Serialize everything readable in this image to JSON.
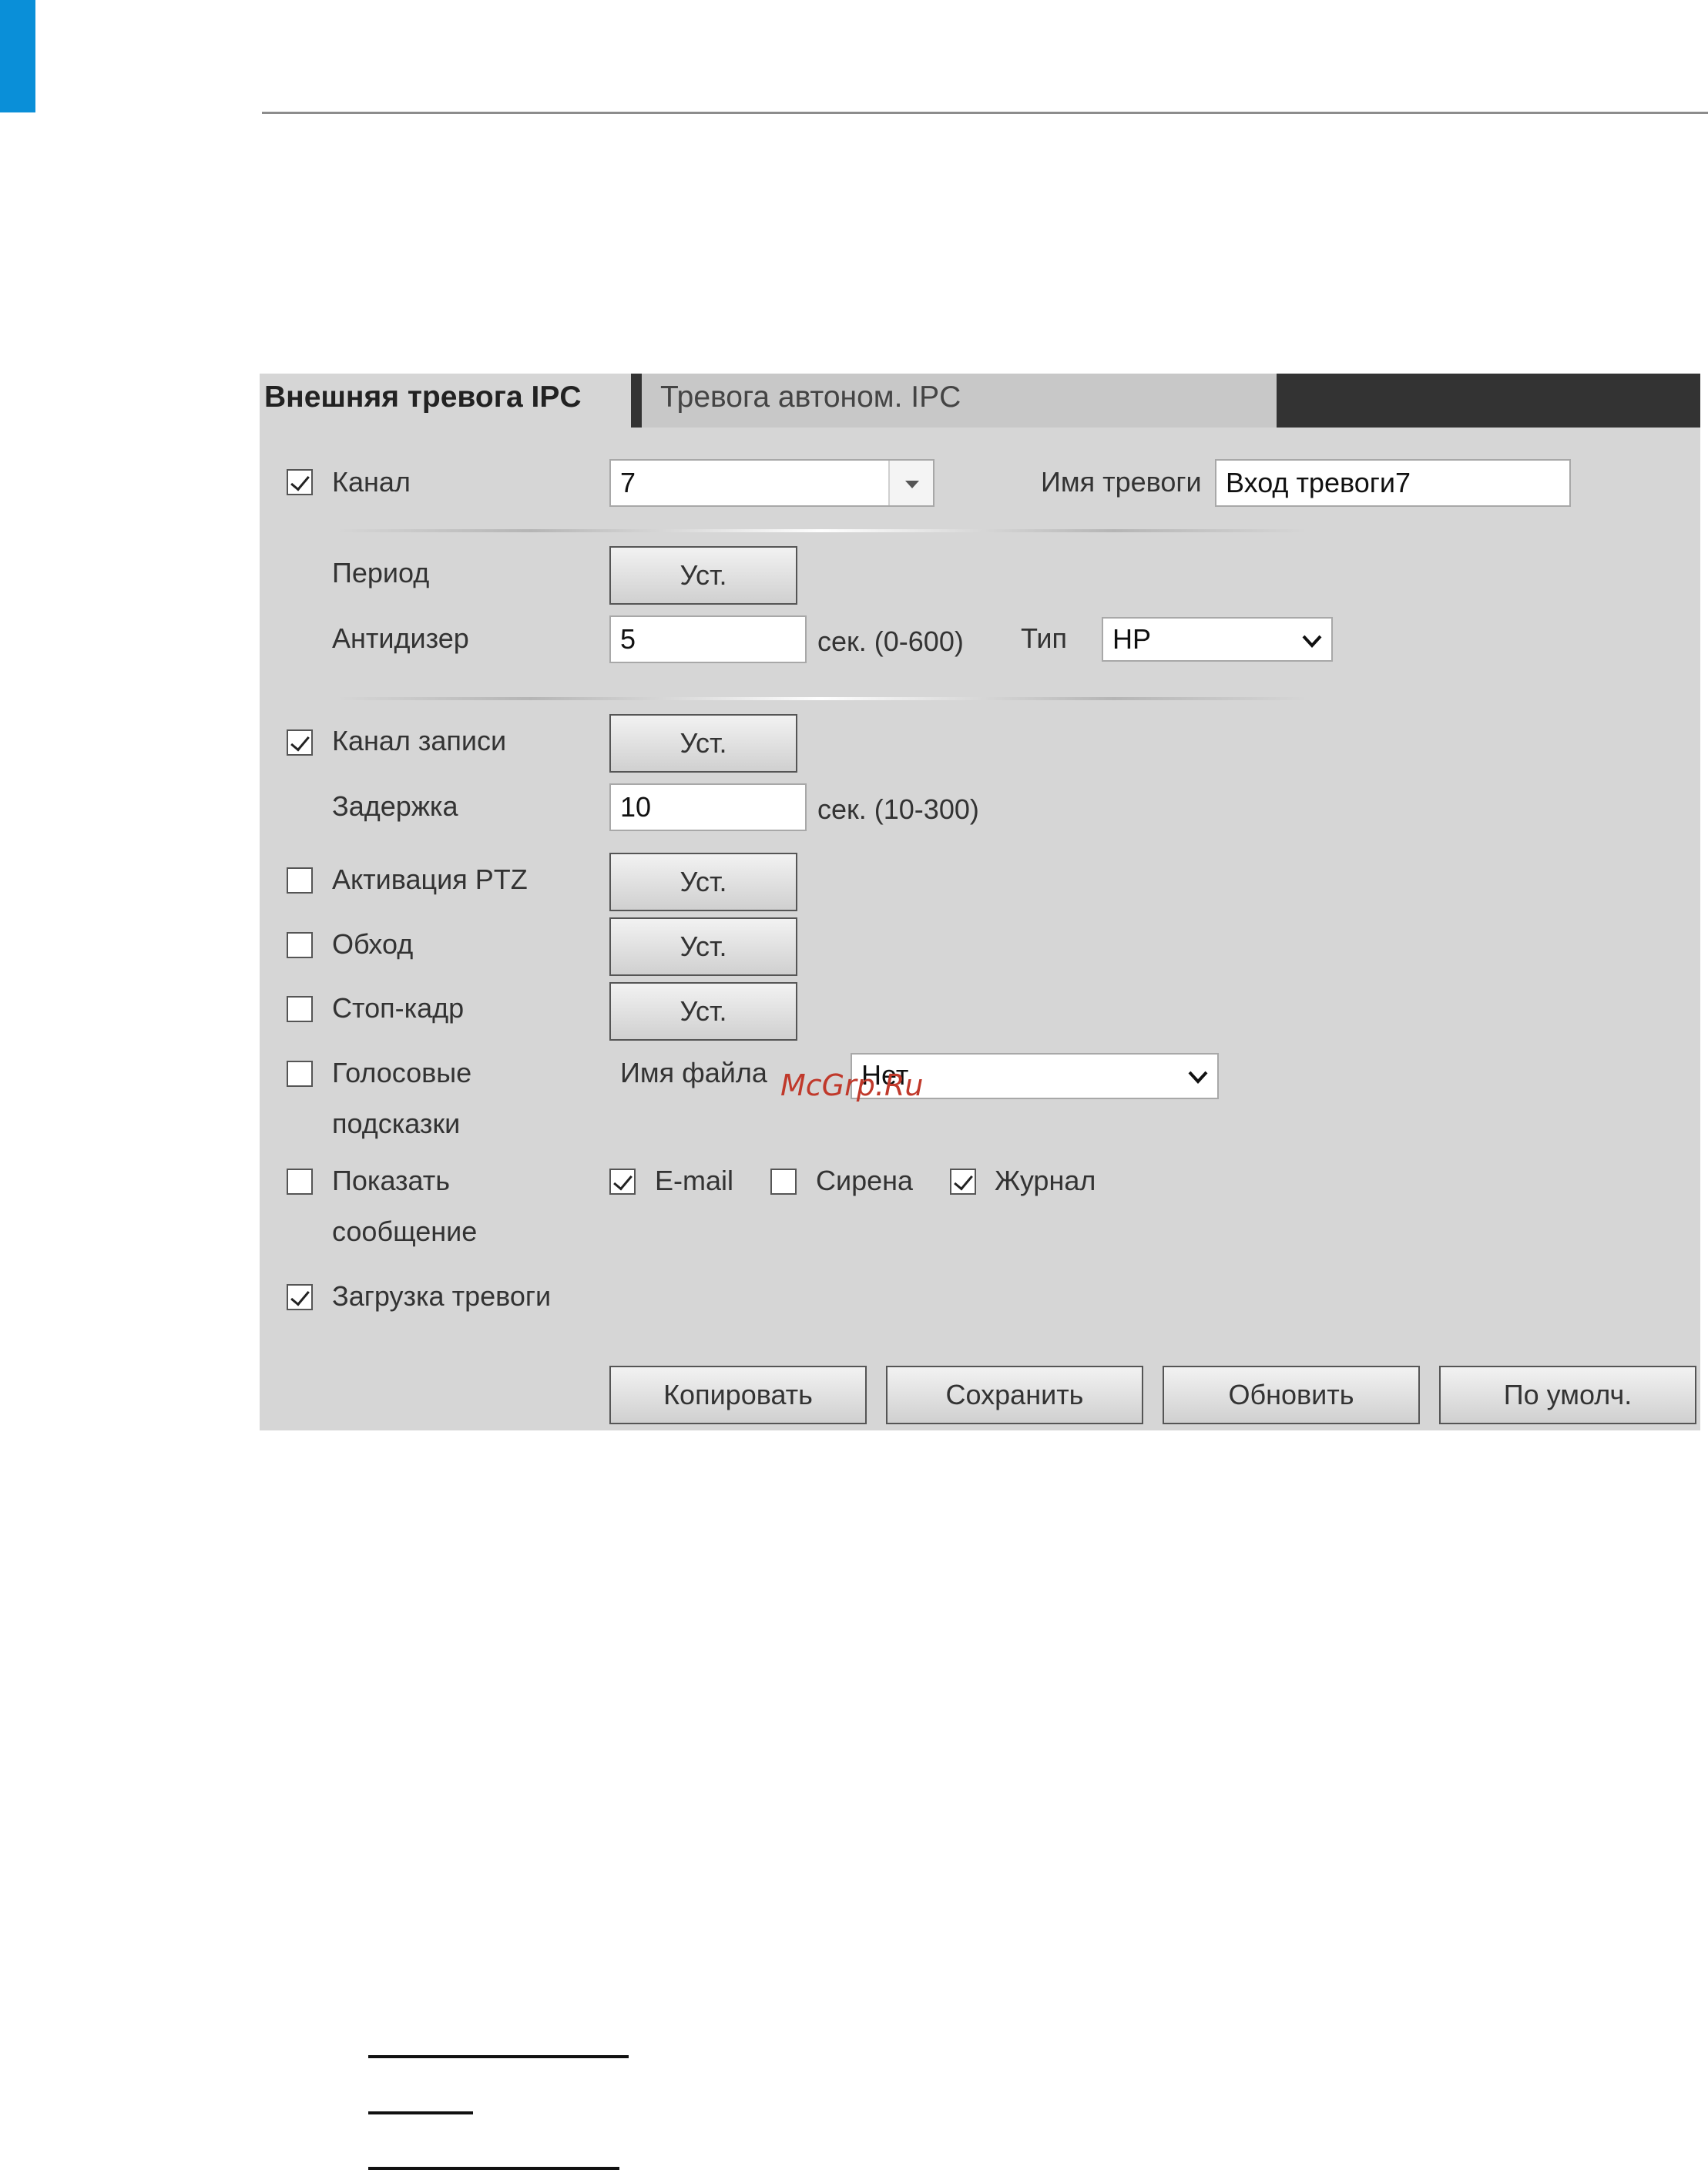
{
  "tabs": {
    "active": "Внешняя тревога IPC",
    "inactive": "Тревога автоном. IPC"
  },
  "form": {
    "channel_label": "Канал",
    "channel_value": "7",
    "alarm_name_label": "Имя тревоги",
    "alarm_name_value": "Вход тревоги7",
    "period_label": "Период",
    "set_label": "Уст.",
    "antidither_label": "Антидизер",
    "antidither_value": "5",
    "antidither_unit": "сек.  (0-600)",
    "type_label": "Тип",
    "type_value": "НР",
    "record_channel_label": "Канал записи",
    "delay_label": "Задержка",
    "delay_value": "10",
    "delay_unit": "сек.  (10-300)",
    "ptz_label": "Активация PTZ",
    "tour_label": "Обход",
    "snapshot_label": "Стоп-кадр",
    "voice_label_1": "Голосовые",
    "voice_label_2": "подсказки",
    "file_name_label": "Имя файла",
    "file_name_value": "Нет",
    "show_msg_label_1": "Показать",
    "show_msg_label_2": "сообщение",
    "email_label": "E-mail",
    "siren_label": "Сирена",
    "log_label": "Журнал",
    "alarm_upload_label": "Загрузка тревоги"
  },
  "checkboxes": {
    "channel": true,
    "record_channel": true,
    "ptz": false,
    "tour": false,
    "snapshot": false,
    "voice": false,
    "show_msg": false,
    "email": true,
    "siren": false,
    "log": true,
    "alarm_upload": true
  },
  "buttons": {
    "copy": "Копировать",
    "save": "Сохранить",
    "refresh": "Обновить",
    "default": "По умолч."
  },
  "watermark": "McGrp.Ru",
  "colors": {
    "accent_blue": "#0a8fd8",
    "panel_bg": "#d6d6d6",
    "tabbar_bg": "#333333",
    "watermark_red": "#c0392b"
  }
}
